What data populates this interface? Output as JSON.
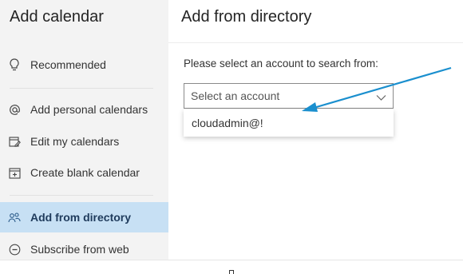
{
  "sidebar": {
    "title": "Add calendar",
    "items": [
      {
        "label": "Recommended",
        "icon": "lightbulb-icon"
      },
      {
        "label": "Add personal calendars",
        "icon": "at-sign-icon"
      },
      {
        "label": "Edit my calendars",
        "icon": "edit-calendar-icon"
      },
      {
        "label": "Create blank calendar",
        "icon": "calendar-plus-icon"
      },
      {
        "label": "Add from directory",
        "icon": "people-icon",
        "active": true
      },
      {
        "label": "Subscribe from web",
        "icon": "link-icon"
      }
    ]
  },
  "main": {
    "title": "Add from directory",
    "prompt": "Please select an account to search from:",
    "select": {
      "placeholder": "Select an account"
    },
    "dropdown_option": "cloudadmin@!"
  },
  "colors": {
    "active_bg": "#c7e0f4",
    "annotation_arrow": "#1a8fce",
    "sidebar_bg": "#f3f3f3"
  }
}
